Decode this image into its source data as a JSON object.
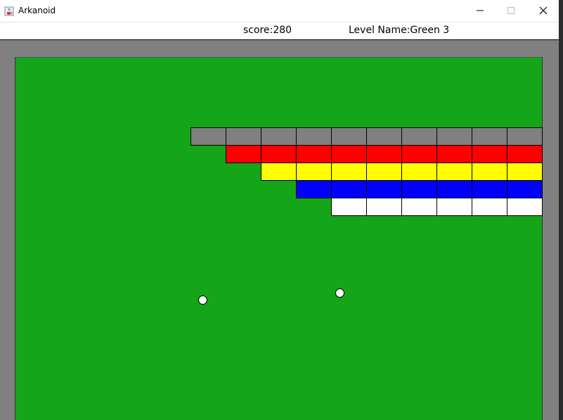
{
  "window": {
    "title": "Arkanoid",
    "icon": "java-cup-icon",
    "controls": [
      "minimize-icon",
      "maximize-icon",
      "close-icon"
    ]
  },
  "info": {
    "score_label": "score:280",
    "level_label": "Level Name:Green 3"
  },
  "colors": {
    "background": "#14a518",
    "wall": "#808080",
    "ball": "#ffffff"
  },
  "block_rows": [
    {
      "color": "#808080",
      "count": 10
    },
    {
      "color": "#ff0000",
      "count": 9
    },
    {
      "color": "#ffff00",
      "count": 8
    },
    {
      "color": "#0000ff",
      "count": 7
    },
    {
      "color": "#ffffff",
      "count": 6
    }
  ],
  "balls": [
    {
      "id": "ball-1"
    },
    {
      "id": "ball-2"
    }
  ]
}
